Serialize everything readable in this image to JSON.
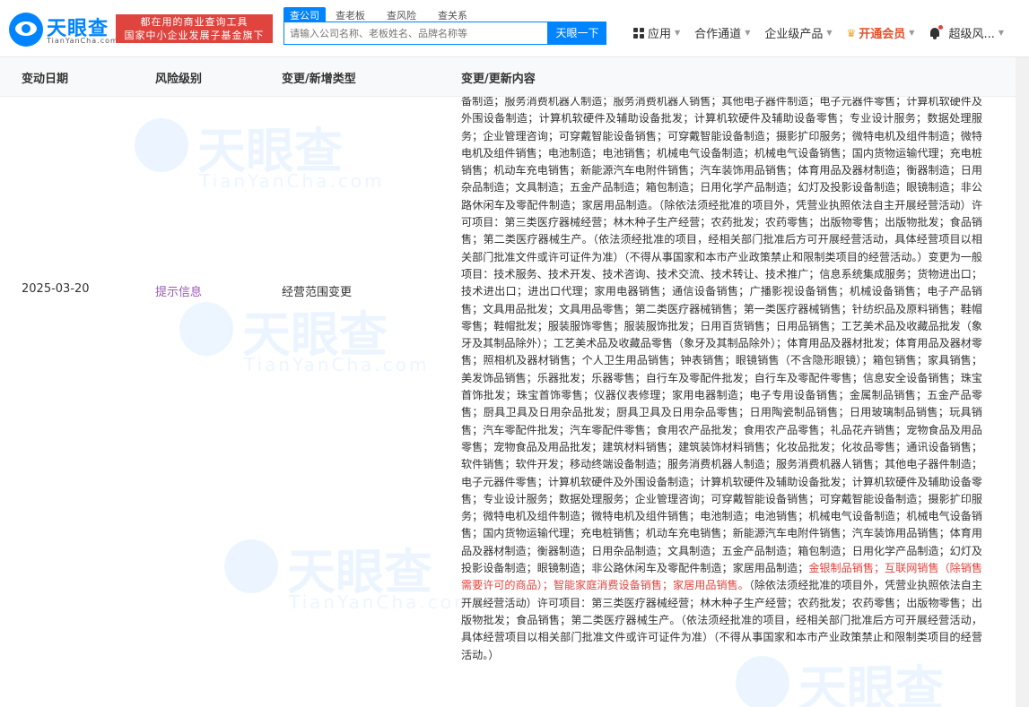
{
  "brand": {
    "name": "天眼查",
    "domain": "TianYanCha.com",
    "slogan_line1": "都在用的商业查询工具",
    "slogan_line2": "国家中小企业发展子基金旗下机构"
  },
  "search": {
    "tabs": [
      "查公司",
      "查老板",
      "查风险",
      "查关系"
    ],
    "placeholder": "请输入公司名称、老板姓名、品牌名称等",
    "button": "天眼一下"
  },
  "nav": {
    "apps": "应用",
    "cooperation": "合作通道",
    "enterprise": "企业级产品",
    "vip": "开通会员",
    "user": "超级风..."
  },
  "table": {
    "headers": [
      "变动日期",
      "风险级别",
      "变更/新增类型",
      "变更/更新内容"
    ],
    "row": {
      "date": "2025-03-20",
      "risk": "提示信息",
      "type": "经营范围变更",
      "content_before": "备制造；服务消费机器人制造；服务消费机器人销售；其他电子器件制造；电子元器件零售；计算机软硬件及外围设备制造；计算机软硬件及辅助设备批发；计算机软硬件及辅助设备零售；专业设计服务；数据处理服务；企业管理咨询；可穿戴智能设备销售；可穿戴智能设备制造；摄影扩印服务；微特电机及组件制造；微特电机及组件销售；电池制造；电池销售；机械电气设备制造；机械电气设备销售；国内货物运输代理；充电桩销售；机动车充电销售；新能源汽车电附件销售；汽车装饰用品销售；体育用品及器材制造；衡器制造；日用杂品制造；文具制造；五金产品制造；箱包制造；日用化学产品制造；幻灯及投影设备制造；眼镜制造；非公路休闲车及零配件制造；家居用品制造。（除依法须经批准的项目外，凭营业执照依法自主开展经营活动）许可项目：第三类医疗器械经营；林木种子生产经营；农药批发；农药零售；出版物零售；出版物批发；食品销售；第二类医疗器械生产。（依法须经批准的项目，经相关部门批准后方可开展经营活动，具体经营项目以相关部门批准文件或许可证件为准）（不得从事国家和本市产业政策禁止和限制类项目的经营活动。）变更为一般项目：技术服务、技术开发、技术咨询、技术交流、技术转让、技术推广；信息系统集成服务；货物进出口；技术进出口；进出口代理；家用电器销售；通信设备销售；广播影视设备销售；机械设备销售；电子产品销售；文具用品批发；文具用品零售；第二类医疗器械销售；第一类医疗器械销售；针纺织品及原料销售；鞋帽零售；鞋帽批发；服装服饰零售；服装服饰批发；日用百货销售；日用品销售；工艺美术品及收藏品批发（象牙及其制品除外）；工艺美术品及收藏品零售（象牙及其制品除外）；体育用品及器材批发；体育用品及器材零售；照相机及器材销售；个人卫生用品销售；钟表销售；眼镜销售（不含隐形眼镜）；箱包销售；家具销售；美发饰品销售；乐器批发；乐器零售；自行车及零配件批发；自行车及零配件零售；信息安全设备销售；珠宝首饰批发；珠宝首饰零售；仪器仪表修理；家用电器制造；电子专用设备销售；金属制品销售；五金产品零售；厨具卫具及日用杂品批发；厨具卫具及日用杂品零售；日用陶瓷制品销售；日用玻璃制品销售；玩具销售；汽车零配件批发；汽车零配件零售；食用农产品批发；食用农产品零售；礼品花卉销售；宠物食品及用品零售；宠物食品及用品批发；建筑材料销售；建筑装饰材料销售；化妆品批发；化妆品零售；通讯设备销售；软件销售；软件开发；移动终端设备制造；服务消费机器人制造；服务消费机器人销售；其他电子器件制造；电子元器件零售；计算机软硬件及外围设备制造；计算机软硬件及辅助设备批发；计算机软硬件及辅助设备零售；专业设计服务；数据处理服务；企业管理咨询；可穿戴智能设备销售；可穿戴智能设备制造；摄影扩印服务；微特电机及组件制造；微特电机及组件销售；电池制造；电池销售；机械电气设备制造；机械电气设备销售；国内货物运输代理；充电桩销售；机动车充电销售；新能源汽车电附件销售；汽车装饰用品销售；体育用品及器材制造；衡器制造；日用杂品制造；文具制造；五金产品制造；箱包制造；日用化学产品制造；幻灯及投影设备制造；眼镜制造；非公路休闲车及零配件制造；家居用品制造；",
      "content_highlight": "金银制品销售；互联网销售（除销售需要许可的商品）；智能家庭消费设备销售；家居用品销售。",
      "content_after": "（除依法须经批准的项目外，凭营业执照依法自主开展经营活动）许可项目：第三类医疗器械经营；林木种子生产经营；农药批发；农药零售；出版物零售；出版物批发；食品销售；第二类医疗器械生产。（依法须经批准的项目，经相关部门批准后方可开展经营活动，具体经营项目以相关部门批准文件或许可证件为准）（不得从事国家和本市产业政策禁止和限制类项目的经营活动。）"
    }
  },
  "watermark": {
    "text": "天眼查",
    "sub": "TianYanCha.com"
  },
  "colors": {
    "brand_blue": "#0084ff",
    "slogan_red": "#e0443e",
    "risk_purple": "#9b59b6",
    "vip_orange": "#e6502b"
  }
}
